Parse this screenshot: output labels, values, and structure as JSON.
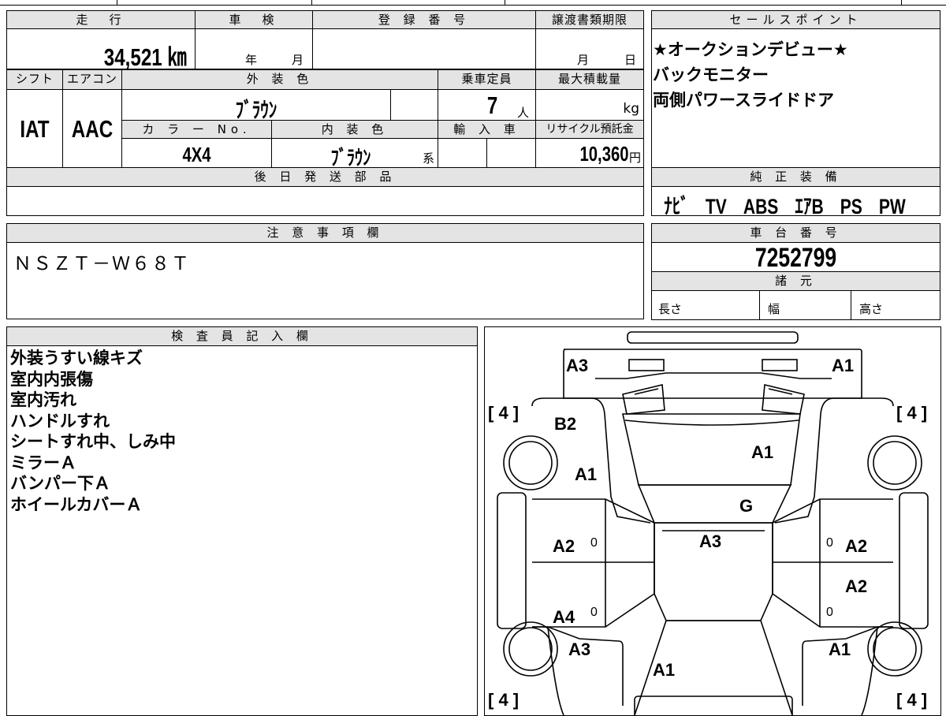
{
  "headers": {
    "mileage": "走　行",
    "inspection": "車　検",
    "registration_no": "登 録 番 号",
    "transfer_deadline": "譲渡書類期限",
    "sales_points": "セールスポイント",
    "shift": "シフト",
    "aircon": "エアコン",
    "exterior_color": "外 装 色",
    "capacity": "乗車定員",
    "max_load": "最大積載量",
    "color_no": "カ ラ ー No.",
    "interior_color": "内 装 色",
    "import": "輸 入 車",
    "recycle": "リサイクル預託金",
    "later_parts": "後 日 発 送 部 品",
    "genuine_equipment": "純 正 装 備",
    "notes": "注 意 事 項 欄",
    "chassis_no": "車 台 番 号",
    "specs": "諸 元",
    "inspector": "検 査 員 記 入 欄"
  },
  "values": {
    "mileage": "34,521 ㎞",
    "inspection_year": "年",
    "inspection_month": "月",
    "deadline_month": "月",
    "deadline_day": "日",
    "shift": "IAT",
    "aircon": "AAC",
    "exterior_color": "ﾌﾞﾗｳﾝ",
    "capacity": "7",
    "capacity_unit": "人",
    "max_load_unit": "kg",
    "color_no": "4X4",
    "interior_color": "ﾌﾞﾗｳﾝ",
    "interior_suffix": "系",
    "recycle": "10,360",
    "recycle_unit": "円",
    "genuine_equipment": "ﾅﾋﾞ　TV　ABS　ｴｱB　PS　PW",
    "notes": "ＮＳＺＴ－Ｗ６８Ｔ",
    "chassis_no": "7252799",
    "length": "長さ",
    "width": "幅",
    "height": "高さ"
  },
  "sales_points": [
    "★オークションデビュー★",
    "バックモニター",
    "両側パワースライドドア"
  ],
  "inspector_notes": [
    "外装うすい線キズ",
    "室内内張傷",
    "室内汚れ",
    "ハンドルすれ",
    "シートすれ中、しみ中",
    "ミラーＡ",
    "バンパー下Ａ",
    "ホイールカバーＡ"
  ],
  "diagram": {
    "front_left": "A3",
    "front_right": "A1",
    "tire_fl": "[ 4 ]",
    "tire_fr": "[ 4 ]",
    "tire_rl": "[ 4 ]",
    "tire_rr": "[ 4 ]",
    "fender_left": "B2",
    "hood": "A1",
    "left_mirror": "A1",
    "windshield": "G",
    "roof": "A3",
    "front_door_left": "A2",
    "front_door_right": "A2",
    "rear_door_right": "A2",
    "rear_door_left": "A4",
    "rear_quarter_left": "A3",
    "rear_quarter_right": "A1",
    "tailgate": "A1",
    "zero": "0"
  }
}
